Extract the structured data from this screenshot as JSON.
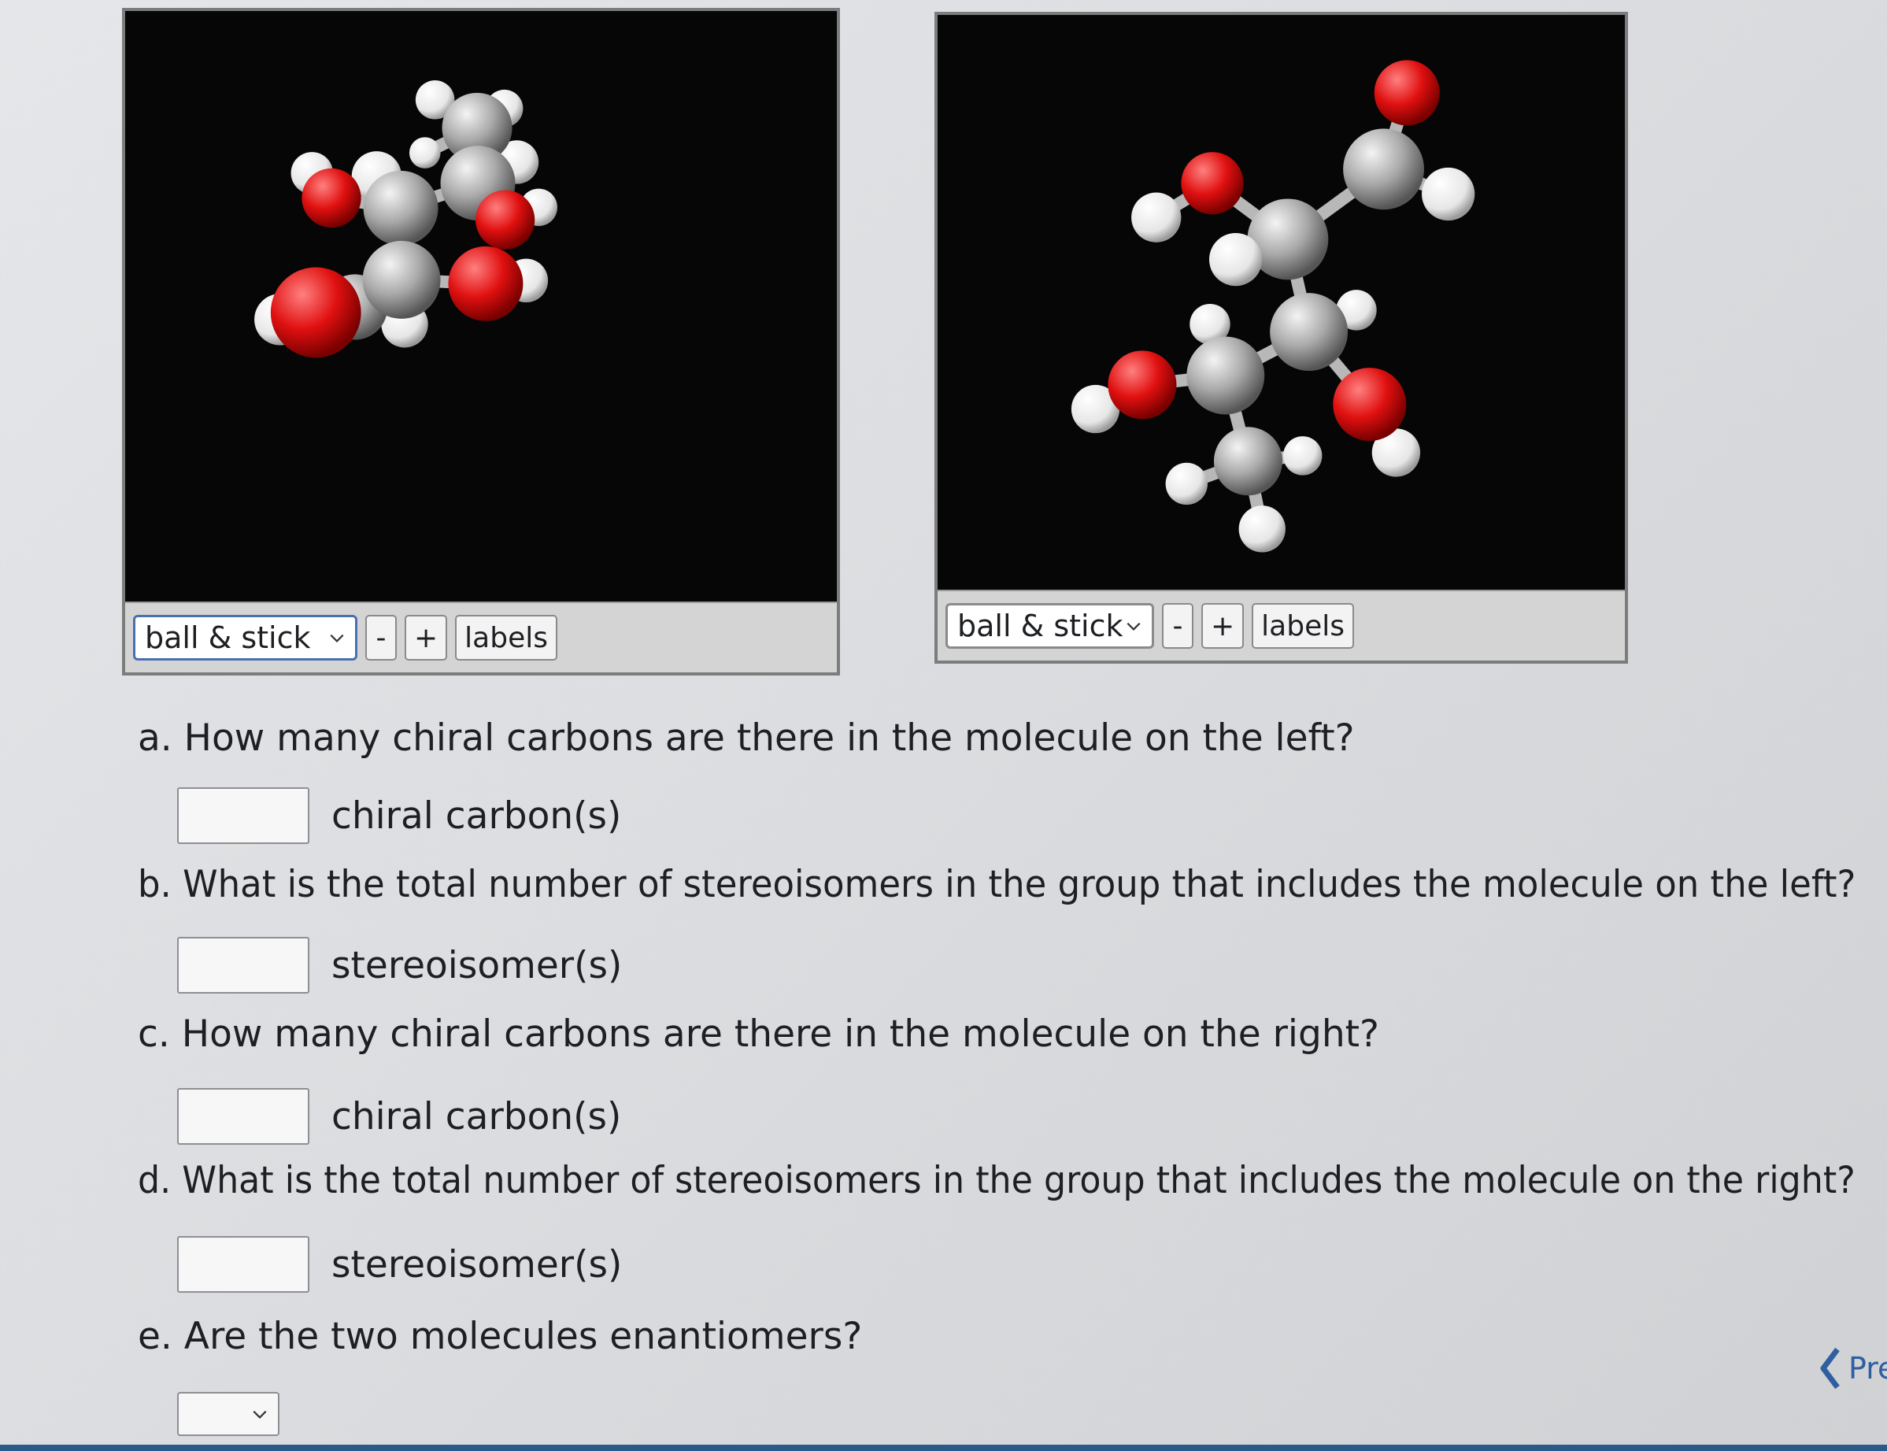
{
  "viewers": {
    "left": {
      "display_mode": "ball & stick",
      "zoom_out": "-",
      "zoom_in": "+",
      "labels": "labels"
    },
    "right": {
      "display_mode": "ball & stick",
      "zoom_out": "-",
      "zoom_in": "+",
      "labels": "labels"
    }
  },
  "questions": {
    "a": {
      "text": "a. How many chiral carbons are there in the molecule on the left?",
      "unit": "chiral carbon(s)",
      "value": ""
    },
    "b": {
      "text": "b. What is the total number of stereoisomers in the group that includes the molecule on the left?",
      "unit": "stereoisomer(s)",
      "value": ""
    },
    "c": {
      "text": "c. How many chiral carbons are there in the molecule on the right?",
      "unit": "chiral carbon(s)",
      "value": ""
    },
    "d": {
      "text": "d. What is the total number of stereoisomers in the group that includes the molecule on the right?",
      "unit": "stereoisomer(s)",
      "value": ""
    },
    "e": {
      "text": "e. Are the two molecules enantiomers?",
      "selected": ""
    }
  },
  "navigation": {
    "prev_label": "Pre"
  },
  "colors": {
    "carbon": "#a9a9a9",
    "hydrogen": "#f2f2f2",
    "oxygen": "#e01010",
    "viewer_bg": "#060606",
    "link": "#2f5fa0"
  }
}
